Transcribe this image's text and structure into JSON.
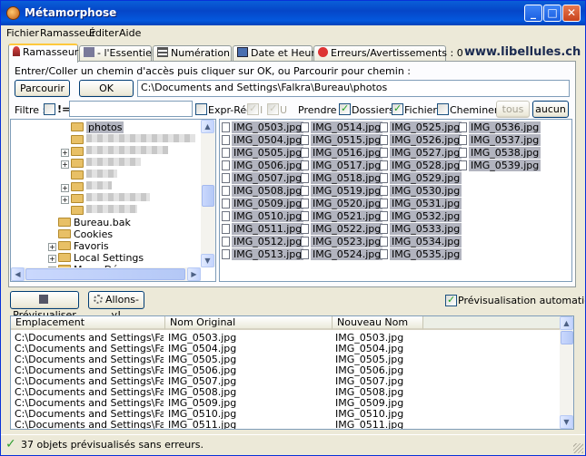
{
  "window": {
    "title": "Métamorphose"
  },
  "menu": [
    "Fichier",
    "Ramasseur",
    "Éditer",
    "Aide"
  ],
  "tabs": [
    "Ramasseur",
    "- l'Essentiel -",
    "Numération",
    "Date et Heure",
    "Erreurs/Avertissements : 0"
  ],
  "site_url": "www.libellules.ch",
  "picker": {
    "instruction": "Entrer/Coller un chemin d'accès puis cliquer sur OK, ou Parcourir pour chemin :",
    "browse_label": "Parcourir",
    "ok_label": "OK",
    "path_value": "C:\\Documents and Settings\\Falkra\\Bureau\\photos"
  },
  "filter": {
    "label": "Filtre :",
    "not_label": "!=",
    "value": "",
    "regex_label": "Expr-Rég",
    "i_label": "I",
    "u_label": "U",
    "take_label": "Prendre :",
    "folders_label": "Dossiers",
    "files_label": "Fichiers",
    "paths_label": "Cheminer",
    "all_label": "tous",
    "none_label": "aucun"
  },
  "tree": {
    "top_item": "photos",
    "items": [
      "Bureau.bak",
      "Cookies",
      "Favoris",
      "Local Settings",
      "Menu Démarrer"
    ]
  },
  "files": [
    "IMG_0503.jpg",
    "IMG_0504.jpg",
    "IMG_0505.jpg",
    "IMG_0506.jpg",
    "IMG_0507.jpg",
    "IMG_0508.jpg",
    "IMG_0509.jpg",
    "IMG_0510.jpg",
    "IMG_0511.jpg",
    "IMG_0512.jpg",
    "IMG_0513.jpg",
    "IMG_0514.jpg",
    "IMG_0515.jpg",
    "IMG_0516.jpg",
    "IMG_0517.jpg",
    "IMG_0518.jpg",
    "IMG_0519.jpg",
    "IMG_0520.jpg",
    "IMG_0521.jpg",
    "IMG_0522.jpg",
    "IMG_0523.jpg",
    "IMG_0524.jpg",
    "IMG_0525.jpg",
    "IMG_0526.jpg",
    "IMG_0527.jpg",
    "IMG_0528.jpg",
    "IMG_0529.jpg",
    "IMG_0530.jpg",
    "IMG_0531.jpg",
    "IMG_0532.jpg",
    "IMG_0533.jpg",
    "IMG_0534.jpg",
    "IMG_0535.jpg",
    "IMG_0536.jpg",
    "IMG_0537.jpg",
    "IMG_0538.jpg",
    "IMG_0539.jpg"
  ],
  "actions": {
    "preview_label": "Prévisualiser",
    "go_label": "Allons-y!",
    "auto_preview_label": "Prévisualisation automatique"
  },
  "results": {
    "headers": [
      "Emplacement",
      "Nom Original",
      "Nouveau Nom"
    ],
    "rows": [
      [
        "C:\\Documents and Settings\\Falkra...",
        "IMG_0503.jpg",
        "IMG_0503.jpg"
      ],
      [
        "C:\\Documents and Settings\\Falkra...",
        "IMG_0504.jpg",
        "IMG_0504.jpg"
      ],
      [
        "C:\\Documents and Settings\\Falkra...",
        "IMG_0505.jpg",
        "IMG_0505.jpg"
      ],
      [
        "C:\\Documents and Settings\\Falkra...",
        "IMG_0506.jpg",
        "IMG_0506.jpg"
      ],
      [
        "C:\\Documents and Settings\\Falkra...",
        "IMG_0507.jpg",
        "IMG_0507.jpg"
      ],
      [
        "C:\\Documents and Settings\\Falkra...",
        "IMG_0508.jpg",
        "IMG_0508.jpg"
      ],
      [
        "C:\\Documents and Settings\\Falkra...",
        "IMG_0509.jpg",
        "IMG_0509.jpg"
      ],
      [
        "C:\\Documents and Settings\\Falkra...",
        "IMG_0510.jpg",
        "IMG_0510.jpg"
      ],
      [
        "C:\\Documents and Settings\\Falkra...",
        "IMG_0511.jpg",
        "IMG_0511.jpg"
      ]
    ]
  },
  "status": {
    "text": "37 objets prévisualisés sans erreurs."
  }
}
